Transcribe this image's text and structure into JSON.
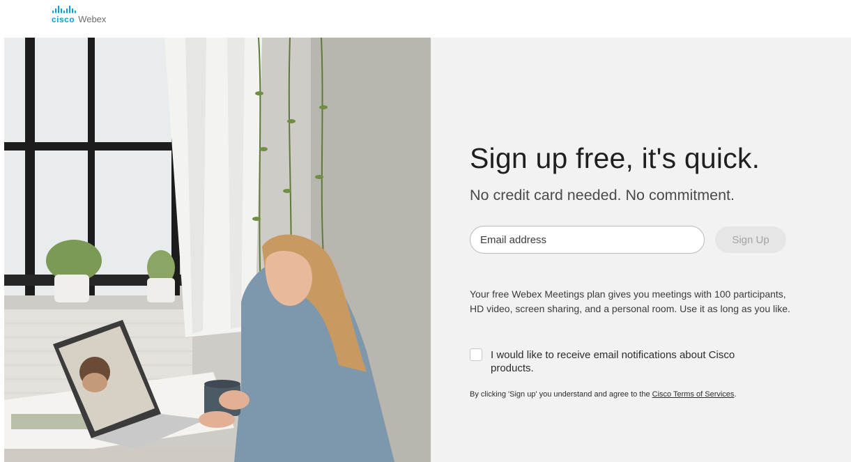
{
  "header": {
    "logo": {
      "brand": "cisco",
      "product": "Webex",
      "icon": "cisco-logo-icon"
    }
  },
  "hero": {
    "image": "woman-laptop-video-call-photo"
  },
  "signup": {
    "title": "Sign up free, it's quick.",
    "subtitle": "No credit card needed. No commitment.",
    "email_placeholder": "Email address",
    "button_label": "Sign Up",
    "description": "Your free Webex Meetings plan gives you meetings with 100 participants, HD video, screen sharing, and a personal room. Use it as long as you like.",
    "checkbox_label": "I would like to receive email notifications about Cisco products.",
    "checkbox_checked": false,
    "terms_prefix": "By clicking 'Sign up' you understand and agree to the ",
    "terms_link": "Cisco Terms of Services",
    "terms_suffix": "."
  },
  "colors": {
    "brand": "#049fd9",
    "panel_bg": "#f2f2f2",
    "button_bg": "#e6e6e6",
    "button_text": "#a3a3a3"
  }
}
